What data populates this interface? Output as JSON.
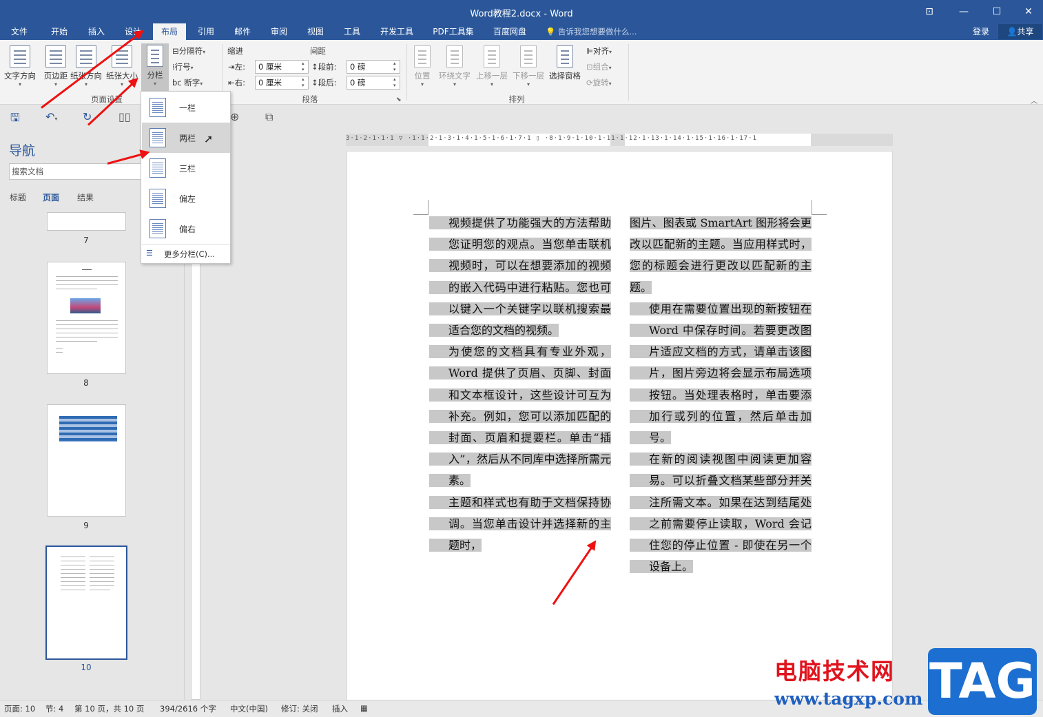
{
  "window": {
    "title": "Word教程2.docx - Word",
    "controls": [
      "⊡",
      "—",
      "☐",
      "✕"
    ]
  },
  "menu": {
    "tabs": [
      "文件",
      "开始",
      "插入",
      "设计",
      "布局",
      "引用",
      "邮件",
      "审阅",
      "视图",
      "工具",
      "开发工具",
      "PDF工具集",
      "百度网盘"
    ],
    "active_tab": "布局",
    "tell_me": "告诉我您想要做什么...",
    "login": "登录",
    "share": "共享"
  },
  "ribbon": {
    "page_setup": {
      "text_direction": "文字方向",
      "margins": "页边距",
      "orientation": "纸张方向",
      "size": "纸张大小",
      "columns": "分栏",
      "breaks": "分隔符",
      "line_numbers": "行号",
      "hyphenation": "断字",
      "group_label": "页面设置"
    },
    "paragraph": {
      "indent_label": "缩进",
      "spacing_label": "间距",
      "left_label": "左:",
      "right_label": "右:",
      "left_value": "0 厘米",
      "right_value": "0 厘米",
      "before_label": "段前:",
      "after_label": "段后:",
      "before_value": "0 磅",
      "after_value": "0 磅",
      "group_label": "段落"
    },
    "arrange": {
      "position": "位置",
      "wrap_text": "环绕文字",
      "bring_forward": "上移一层",
      "send_backward": "下移一层",
      "selection_pane": "选择窗格",
      "align": "对齐",
      "group": "组合",
      "rotate": "旋转",
      "group_label": "排列"
    }
  },
  "columns_menu": {
    "items": [
      "一栏",
      "两栏",
      "三栏",
      "偏左",
      "偏右"
    ],
    "hovered": "两栏",
    "more": "更多分栏(C)..."
  },
  "nav": {
    "title": "导航",
    "search_placeholder": "搜索文档",
    "tabs": [
      "标题",
      "页面",
      "结果"
    ],
    "active_tab": "页面",
    "pages": [
      "7",
      "8",
      "9",
      "10"
    ],
    "selected_page": "10"
  },
  "ruler": {
    "numbers": "3·1·2·1·1·1 ▽ ·1·1·2·1·3·1·4·1·5·1·6·1·7·1 ▯ ·8·1·9·1·10·1·11·1·12·1·13·1·14·1·15·1·16·1·17·1"
  },
  "document": {
    "left_column": [
      "视频提供了功能强大的方法帮助您证明您的观点。当您单击联机视频时，可以在想要添加的视频的嵌入代码中进行粘贴。您也可以键入一个关键字以联机搜索最适合您的文档的视频。",
      "为使您的文档具有专业外观，Word 提供了页眉、页脚、封面和文本框设计，这些设计可互为补充。例如，您可以添加匹配的封面、页眉和提要栏。单击“插入”，然后从不同库中选择所需元素。",
      "主题和样式也有助于文档保持协调。当您单击设计并选择新的主题时，"
    ],
    "right_column": [
      "图片、图表或 SmartArt 图形将会更改以匹配新的主题。当应用样式时，您的标题会进行更改以匹配新的主题。",
      "使用在需要位置出现的新按钮在 Word 中保存时间。若要更改图片适应文档的方式，请单击该图片，图片旁边将会显示布局选项按钮。当处理表格时，单击要添加行或列的位置，然后单击加号。",
      "在新的阅读视图中阅读更加容易。可以折叠文档某些部分并关注所需文本。如果在达到结尾处之前需要停止读取，Word 会记住您的停止位置 - 即使在另一个设备上。"
    ]
  },
  "status": {
    "page": "页面: 10",
    "section": "节: 4",
    "page_of": "第 10 页，共 10 页",
    "words": "394/2616 个字",
    "language": "中文(中国)",
    "track": "修订: 关闭",
    "insert": "插入"
  },
  "watermark": {
    "brand": "电脑技术网",
    "url": "www.tagxp.com",
    "logo": "TAG"
  },
  "colors": {
    "accent": "#2b579a",
    "highlight": "#c8c8c8",
    "annotation_arrow": "#e11111"
  }
}
